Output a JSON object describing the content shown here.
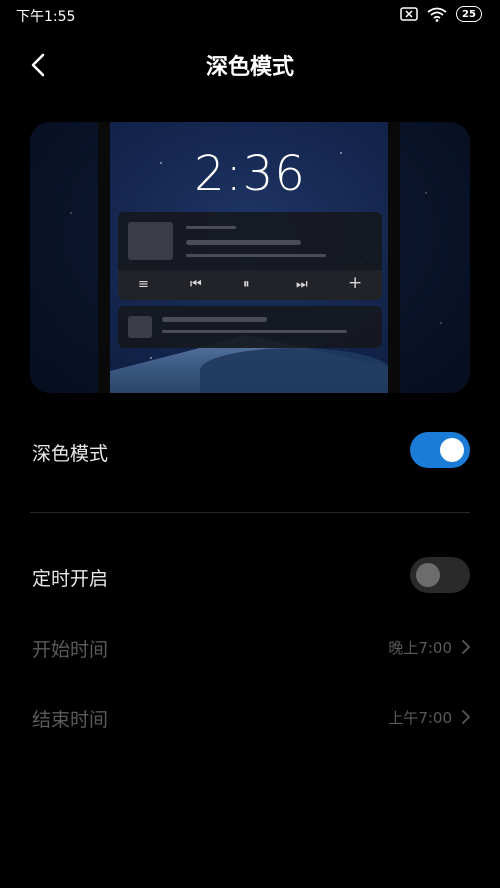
{
  "status_bar": {
    "time": "下午1:55",
    "battery": "25"
  },
  "header": {
    "title": "深色模式"
  },
  "preview": {
    "lock_time": "2:36"
  },
  "settings": {
    "dark_mode": {
      "label": "深色模式",
      "enabled": true
    },
    "schedule": {
      "label": "定时开启",
      "enabled": false
    },
    "start_time": {
      "label": "开始时间",
      "value": "晚上7:00"
    },
    "end_time": {
      "label": "结束时间",
      "value": "上午7:00"
    }
  },
  "colors": {
    "accent": "#1a7cd6",
    "background": "#000000"
  }
}
